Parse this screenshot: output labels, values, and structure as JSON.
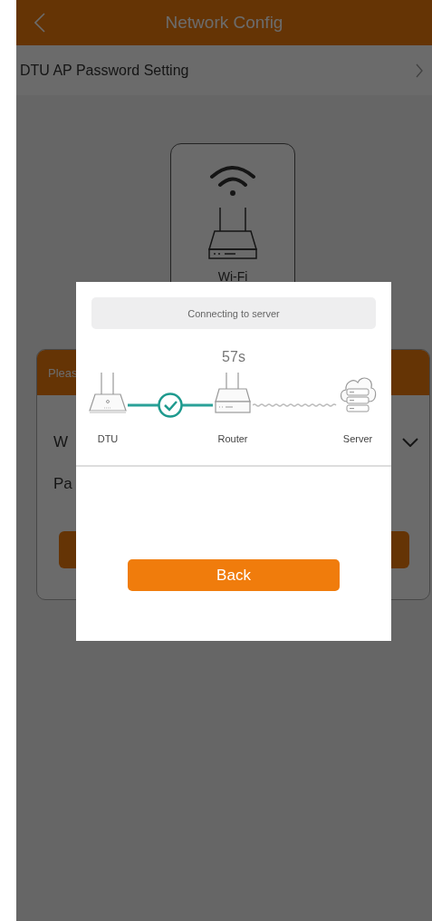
{
  "header": {
    "title": "Network Config"
  },
  "settings_row": {
    "label": "DTU AP Password Setting"
  },
  "mode_card": {
    "label": "Wi-Fi"
  },
  "form_card": {
    "header": "Pleas",
    "field_1_label": "W",
    "field_2_label": "Pa"
  },
  "dialog": {
    "status": "Connecting to server",
    "countdown": "57s",
    "nodes": [
      {
        "label": "DTU",
        "kind": "dtu"
      },
      {
        "label": "Router",
        "kind": "router"
      },
      {
        "label": "Server",
        "kind": "server"
      }
    ],
    "links": [
      {
        "connected": true
      },
      {
        "connected": false
      }
    ],
    "button": "Back"
  }
}
